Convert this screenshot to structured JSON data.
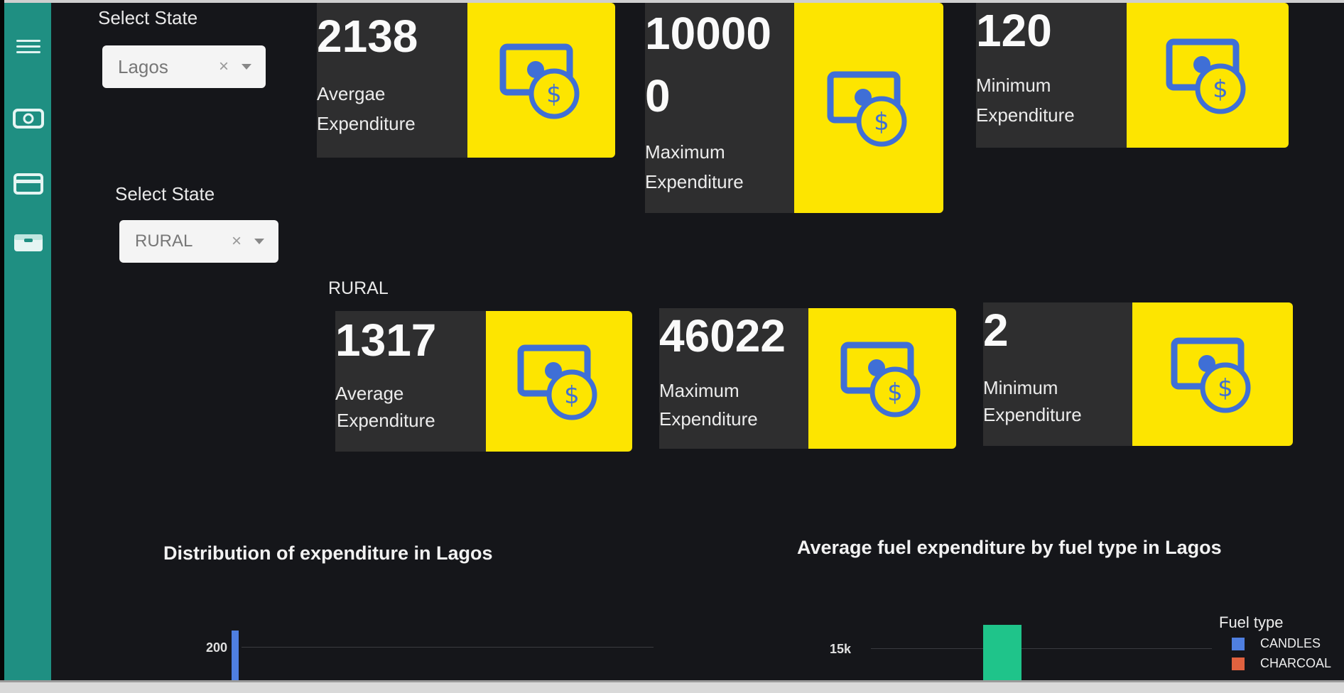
{
  "sidebar": {
    "items": [
      {
        "icon": "menu-icon"
      },
      {
        "icon": "cash-icon"
      },
      {
        "icon": "card-icon"
      },
      {
        "icon": "wallet-icon"
      }
    ]
  },
  "filters": {
    "state_label": "Select State",
    "state_value": "Lagos",
    "sector_label": "Select State",
    "sector_value": "RURAL",
    "clear_symbol": "×"
  },
  "state_cards": [
    {
      "value": "2138",
      "label_line1": "Avergae",
      "label_line2": "Expenditure"
    },
    {
      "value_line1": "10000",
      "value_line2": "0",
      "label_line1": "Maximum",
      "label_line2": "Expenditure"
    },
    {
      "value": "120",
      "label_line1": "Minimum",
      "label_line2": "Expenditure"
    }
  ],
  "sector_heading": "RURAL",
  "sector_cards": [
    {
      "value": "1317",
      "label_line1": "Average",
      "label_line2": "Expenditure"
    },
    {
      "value": "46022",
      "label_line1": "Maximum",
      "label_line2": "Expenditure"
    },
    {
      "value": "2",
      "label_line1": "Minimum",
      "label_line2": "Expenditure"
    }
  ],
  "colors": {
    "accent_teal": "#1f8f82",
    "card_yellow": "#fde500",
    "icon_blue": "#3f6fd6",
    "bar_blue": "#4f7fe0",
    "bar_green": "#1fc48a",
    "legend_orange": "#e0623f"
  },
  "charts": {
    "left_title": "Distribution of expenditure in Lagos",
    "right_title": "Average fuel expenditure by fuel type in Lagos"
  },
  "chart_data": [
    {
      "type": "bar",
      "title": "Distribution of expenditure in Lagos",
      "y_ticks": [
        "200"
      ],
      "series": [
        {
          "values": [
            200
          ]
        }
      ]
    },
    {
      "type": "bar",
      "title": "Average fuel expenditure by fuel type in Lagos",
      "y_ticks": [
        "15k"
      ],
      "legend_title": "Fuel type",
      "legend": [
        {
          "name": "CANDLES",
          "color": "#4f7fe0"
        },
        {
          "name": "CHARCOAL",
          "color": "#e0623f"
        }
      ],
      "series": [
        {
          "values": [
            15000
          ]
        }
      ]
    }
  ]
}
